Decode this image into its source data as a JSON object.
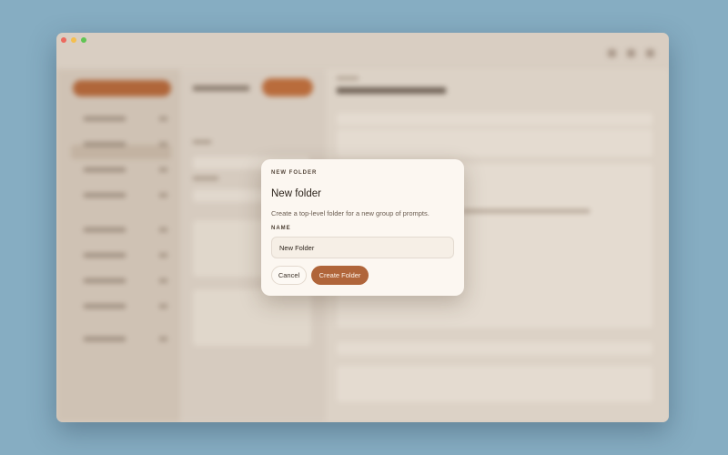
{
  "dialog": {
    "eyebrow": "NEW FOLDER",
    "title": "New folder",
    "description": "Create a top-level folder for a new group of prompts.",
    "name_label": "NAME",
    "name_value": "New Folder",
    "cancel_label": "Cancel",
    "create_label": "Create Folder"
  },
  "colors": {
    "desktop": "#86adc2",
    "accent": "#b0653a",
    "modal_background": "#fcf7f1"
  }
}
